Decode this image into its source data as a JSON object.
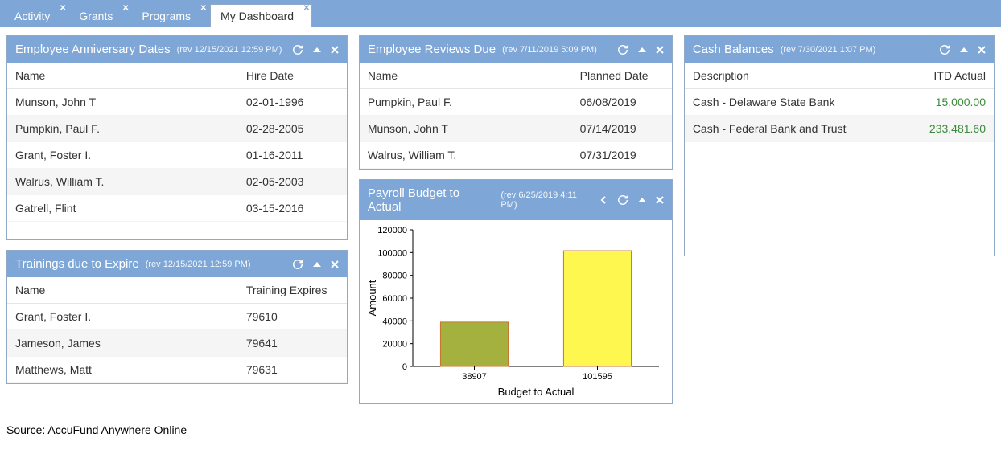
{
  "tabs": [
    {
      "label": "Activity",
      "active": false
    },
    {
      "label": "Grants",
      "active": false
    },
    {
      "label": "Programs",
      "active": false
    },
    {
      "label": "My Dashboard",
      "active": true
    }
  ],
  "widgets": {
    "anniversary": {
      "title": "Employee Anniversary Dates",
      "rev": "(rev 12/15/2021 12:59 PM)",
      "columns": [
        "Name",
        "Hire Date"
      ],
      "rows": [
        [
          "Munson, John T",
          "02-01-1996"
        ],
        [
          "Pumpkin, Paul F.",
          "02-28-2005"
        ],
        [
          "Grant, Foster I.",
          "01-16-2011"
        ],
        [
          "Walrus, William T.",
          "02-05-2003"
        ],
        [
          "Gatrell, Flint",
          "03-15-2016"
        ]
      ]
    },
    "trainings": {
      "title": "Trainings due to Expire",
      "rev": "(rev 12/15/2021 12:59 PM)",
      "columns": [
        "Name",
        "Training Expires"
      ],
      "rows": [
        [
          "Grant, Foster I.",
          "79610"
        ],
        [
          "Jameson, James",
          "79641"
        ],
        [
          "Matthews, Matt",
          "79631"
        ]
      ]
    },
    "reviews": {
      "title": "Employee Reviews Due",
      "rev": "(rev 7/11/2019 5:09 PM)",
      "columns": [
        "Name",
        "Planned Date"
      ],
      "rows": [
        [
          "Pumpkin, Paul F.",
          "06/08/2019"
        ],
        [
          "Munson, John T",
          "07/14/2019"
        ],
        [
          "Walrus, William T.",
          "07/31/2019"
        ]
      ]
    },
    "payroll": {
      "title": "Payroll Budget to Actual",
      "rev": "(rev 6/25/2019 4:11 PM)"
    },
    "cash": {
      "title": "Cash Balances",
      "rev": "(rev 7/30/2021 1:07 PM)",
      "columns": [
        "Description",
        "ITD Actual"
      ],
      "rows": [
        [
          "Cash - Delaware State Bank",
          "15,000.00"
        ],
        [
          "Cash - Federal Bank and Trust",
          "233,481.60"
        ]
      ]
    }
  },
  "chart_data": {
    "type": "bar",
    "categories": [
      "38907",
      "101595"
    ],
    "values": [
      38907,
      101595
    ],
    "colors": [
      "#a4b13f",
      "#fef750"
    ],
    "title": "",
    "xlabel": "Budget to Actual",
    "ylabel": "Amount",
    "ylim": [
      0,
      120000
    ],
    "yticks": [
      0,
      20000,
      40000,
      60000,
      80000,
      100000,
      120000
    ]
  },
  "source": "Source: AccuFund Anywhere Online"
}
